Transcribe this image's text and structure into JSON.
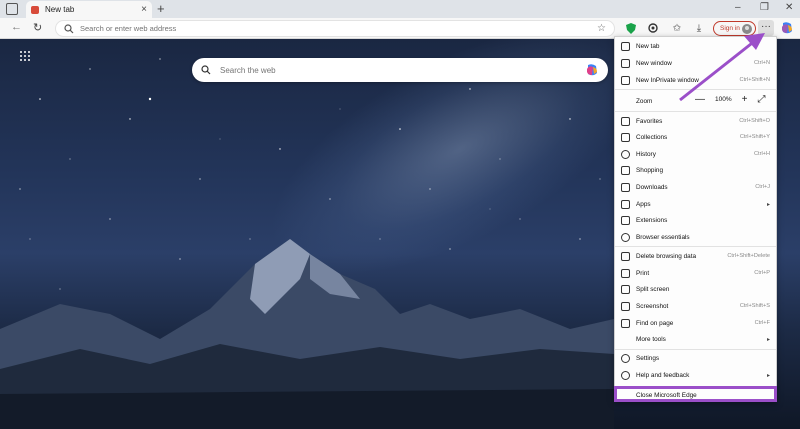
{
  "tab": {
    "title": "New tab"
  },
  "address": {
    "placeholder": "Search or enter web address"
  },
  "toolbar": {
    "signin_label": "Sign in",
    "more_label": "···"
  },
  "ntp": {
    "search_placeholder": "Search the web"
  },
  "menu": {
    "items": [
      {
        "label": "New tab",
        "shortcut": ""
      },
      {
        "label": "New window",
        "shortcut": "Ctrl+N"
      },
      {
        "label": "New InPrivate window",
        "shortcut": "Ctrl+Shift+N"
      },
      {
        "label": "Zoom",
        "shortcut": ""
      },
      {
        "label": "Favorites",
        "shortcut": "Ctrl+Shift+O"
      },
      {
        "label": "Collections",
        "shortcut": "Ctrl+Shift+Y"
      },
      {
        "label": "History",
        "shortcut": "Ctrl+H"
      },
      {
        "label": "Shopping",
        "shortcut": ""
      },
      {
        "label": "Downloads",
        "shortcut": "Ctrl+J"
      },
      {
        "label": "Apps",
        "shortcut": ""
      },
      {
        "label": "Extensions",
        "shortcut": ""
      },
      {
        "label": "Browser essentials",
        "shortcut": ""
      },
      {
        "label": "Delete browsing data",
        "shortcut": "Ctrl+Shift+Delete"
      },
      {
        "label": "Print",
        "shortcut": "Ctrl+P"
      },
      {
        "label": "Split screen",
        "shortcut": ""
      },
      {
        "label": "Screenshot",
        "shortcut": "Ctrl+Shift+S"
      },
      {
        "label": "Find on page",
        "shortcut": "Ctrl+F"
      },
      {
        "label": "More tools",
        "shortcut": ""
      },
      {
        "label": "Settings",
        "shortcut": ""
      },
      {
        "label": "Help and feedback",
        "shortcut": ""
      },
      {
        "label": "Close Microsoft Edge",
        "shortcut": ""
      }
    ],
    "zoom": {
      "value": "100%",
      "minus": "—",
      "plus": "+",
      "fullscreen": "⤢"
    }
  },
  "colors": {
    "highlight": "#9b4fc9",
    "signin": "#c0392b"
  }
}
